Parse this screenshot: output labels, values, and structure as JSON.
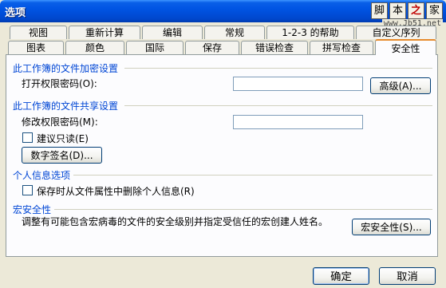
{
  "window": {
    "title": "选项"
  },
  "watermark": {
    "chars": [
      "脚",
      "本",
      "之",
      "家"
    ],
    "url": "www.Jb51.net"
  },
  "tabs_row1": [
    "视图",
    "重新计算",
    "编辑",
    "常规",
    "1-2-3 的帮助",
    "自定义序列"
  ],
  "tabs_row2": [
    "图表",
    "颜色",
    "国际",
    "保存",
    "错误检查",
    "拼写检查",
    "安全性"
  ],
  "active_tab": "安全性",
  "encrypt": {
    "title": "此工作簿的文件加密设置",
    "open_password_label": "打开权限密码(O):",
    "open_password_value": "",
    "advanced_button": "高级(A)..."
  },
  "sharing": {
    "title": "此工作簿的文件共享设置",
    "modify_password_label": "修改权限密码(M):",
    "modify_password_value": "",
    "readonly_label": "建议只读(E)",
    "signature_button": "数字签名(D)..."
  },
  "privacy": {
    "title": "个人信息选项",
    "remove_info_label": "保存时从文件属性中删除个人信息(R)"
  },
  "macro": {
    "title": "宏安全性",
    "description": "调整有可能包含宏病毒的文件的安全级别并指定受信任的宏创建人姓名。",
    "button": "宏安全性(S)..."
  },
  "footer": {
    "ok": "确定",
    "cancel": "取消"
  }
}
